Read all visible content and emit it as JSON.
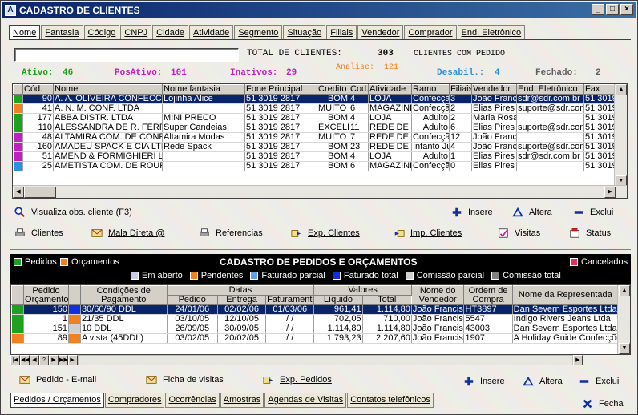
{
  "window": {
    "title": "CADASTRO DE CLIENTES"
  },
  "top_tabs": [
    "Nome",
    "Fantasia",
    "Código",
    "CNPJ",
    "Cidade",
    "Atividade",
    "Segmento",
    "Situação",
    "Filiais",
    "Vendedor",
    "Comprador",
    "End. Eletrônico"
  ],
  "search": {
    "value": ""
  },
  "totals": {
    "total_label": "TOTAL DE CLIENTES:",
    "total_value": "303",
    "clients_with_order": "CLIENTES COM PEDIDO"
  },
  "stats": {
    "ativo": "Ativo:",
    "ativo_v": "46",
    "posativo": "PosAtivo:",
    "posativo_v": "101",
    "inativos": "Inativos:",
    "inativos_v": "29",
    "analise": "Analise:",
    "analise_v": "121",
    "desabil": "Desabil.:",
    "desabil_v": "4",
    "fechado": "Fechado:",
    "fechado_v": "2"
  },
  "clients": {
    "columns": [
      "Cód.",
      "Nome",
      "Nome fantasia",
      "Fone Principal",
      "Credito",
      "Cod.",
      "Atividade",
      "Ramo",
      "Filiais",
      "Vendedor",
      "End. Eletrônico",
      "Fax"
    ],
    "rows": [
      {
        "status": "#20a020",
        "cells": [
          "90",
          "A. A. OLIVEIRA CONFECCOES",
          "Lojinha Alice",
          "51 3019 2817",
          "BOM",
          "4",
          "LOJA",
          "Confecção",
          "3",
          "João Francisco",
          "sdr@sdr.com.br",
          "51 3019"
        ]
      },
      {
        "status": "#f08020",
        "cells": [
          "41",
          "A. N. M. CONF. LTDA",
          "",
          "51 3019 2817",
          "MUITO BOM",
          "6",
          "MAGAZINE",
          "Confecção",
          "2",
          "Elias Pires",
          "suporte@sdr.com",
          "51 3019"
        ]
      },
      {
        "status": "#20a020",
        "cells": [
          "177",
          "ABBA DISTR. LTDA",
          "MINI PRECO",
          "51 3019 2817",
          "BOM",
          "4",
          "LOJA",
          "Adulto",
          "2",
          "Maria Rosa",
          "",
          "51 3019"
        ]
      },
      {
        "status": "#20a020",
        "cells": [
          "110",
          "ALESSANDRA DE R. FERREIRA",
          "Super Candeias",
          "51 3019 2817",
          "EXCELENTE",
          "11",
          "REDE DE LOJAS",
          "Adulto",
          "6",
          "Elias Pires",
          "suporte@sdr.com",
          "51 3019"
        ]
      },
      {
        "status": "#c020c0",
        "cells": [
          "48",
          "ALTAMIRA COM. DE CONFECCOES",
          "Altamira Modas",
          "51 3019 2817",
          "MUITO BOM",
          "7",
          "REDE DE LOJAS",
          "Confecção",
          "12",
          "João Francisco",
          "",
          "51 3019"
        ]
      },
      {
        "status": "#c020c0",
        "cells": [
          "160",
          "AMADEU SPACK E CIA LTDA",
          "Rede Spack",
          "51 3019 2817",
          "BOM",
          "23",
          "REDE DE LOJAS",
          "Infanto Juvenil",
          "4",
          "João Francisco",
          "suporte@sdr.com",
          "51 3019"
        ]
      },
      {
        "status": "#c020c0",
        "cells": [
          "51",
          "AMEND & FORMIGHIERI LTDA",
          "",
          "51 3019 2817",
          "BOM",
          "4",
          "LOJA",
          "Adulto",
          "1",
          "Elias Pires",
          "sdr@sdr.com.br",
          "51 3019"
        ]
      },
      {
        "status": "#3090e0",
        "cells": [
          "25",
          "AMETISTA COM. DE ROUPAS",
          "",
          "51 3019 2817",
          "BOM",
          "6",
          "MAGAZINE",
          "Confecção",
          "0",
          "Elias Pires",
          "",
          "51 3019"
        ]
      }
    ]
  },
  "client_actions": {
    "obs": "Visualiza obs. cliente (F3)",
    "insere": "Insere",
    "altera": "Altera",
    "exclui": "Exclui"
  },
  "toolbar": [
    "Clientes",
    "Mala Direta @",
    "Referencias",
    "Exp. Clientes",
    "Imp. Clientes",
    "Visitas",
    "Status"
  ],
  "orders_header": {
    "pedidos": "Pedidos",
    "orcamentos": "Orçamentos",
    "title": "CADASTRO DE PEDIDOS E ORÇAMENTOS",
    "cancelados": "Cancelados"
  },
  "order_legend": [
    {
      "label": "Em aberto",
      "color": "#c8c8e8"
    },
    {
      "label": "Pendentes",
      "color": "#f08020"
    },
    {
      "label": "Faturado parcial",
      "color": "#60a0e8"
    },
    {
      "label": "Faturado total",
      "color": "#1030e0"
    },
    {
      "label": "Comissão parcial",
      "color": "#d0d0d0"
    },
    {
      "label": "Comissão total",
      "color": "#808080"
    }
  ],
  "colors": {
    "pedido": "#20a020",
    "orcamento": "#f08020",
    "cancelado": "#e03060"
  },
  "orders": {
    "group_headers": {
      "datas": "Datas",
      "valores": "Valores"
    },
    "columns": [
      "Pedido Orçamento",
      "Condições de Pagamento",
      "Pedido",
      "Entrega",
      "Faturamento",
      "Líquido",
      "Total",
      "Nome do Vendedor",
      "Ordem de Compra",
      "Nome da Representada"
    ],
    "rows": [
      {
        "left": "#20a020",
        "flag": "#1030e0",
        "cells": [
          "150",
          "30/60/90 DDL",
          "24/01/06",
          "02/02/06",
          "01/03/06",
          "961,41",
          "1.114,80",
          "João Francisco",
          "HT3897",
          "Dan Severn Esportes Ltda"
        ]
      },
      {
        "left": "#20a020",
        "flag": "#f08020",
        "cells": [
          "1",
          "21/35 DDL",
          "03/10/05",
          "12/10/05",
          "/ /",
          "702,05",
          "710,00",
          "João Francisco",
          "5547",
          "Indigo Rivers Jeans Ltda"
        ]
      },
      {
        "left": "#20a020",
        "flag": "#d0d0d0",
        "cells": [
          "151",
          "10 DDL",
          "26/09/05",
          "30/09/05",
          "/ /",
          "1.114,80",
          "1.114,80",
          "João Francisco",
          "43003",
          "Dan Severn Esportes Ltda"
        ]
      },
      {
        "left": "#f08020",
        "flag": "#f08020",
        "cells": [
          "89",
          "A vista (45DDL)",
          "03/02/05",
          "20/02/05",
          "/ /",
          "1.793,23",
          "2.207,60",
          "João Francisco",
          "1907",
          "A Holiday Guide Confecções"
        ]
      }
    ]
  },
  "order_actions": {
    "email": "Pedido - E-mail",
    "ficha": "Ficha de visitas",
    "exp": "Exp. Pedidos",
    "insere": "Insere",
    "altera": "Altera",
    "exclui": "Exclui"
  },
  "bottom_tabs": [
    "Pedidos / Orçamentos",
    "Compradores",
    "Ocorrências",
    "Amostras",
    "Agendas de Visitas",
    "Contatos telefônicos"
  ],
  "fecha": "Fecha"
}
